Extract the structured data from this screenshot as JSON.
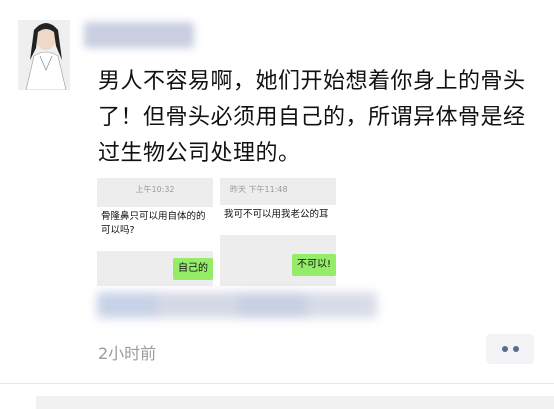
{
  "post": {
    "text": "男人不容易啊，她们开始想着你身上的骨头了！但骨头必须用自己的，所谓异体骨是经过生物公司处理的。",
    "time_label": "2小时前"
  },
  "screenshot_left": {
    "time": "上午10:32",
    "incoming_text": "骨隆鼻只可以用自体的的可以吗?",
    "reply_text": "自己的"
  },
  "screenshot_right": {
    "time": "昨天 下午11:48",
    "incoming_text": "我可不可以用我老公的耳",
    "reply_text": "不可以!"
  },
  "icons": {
    "avatar": "avatar-image",
    "more": "more-dots-icon"
  }
}
